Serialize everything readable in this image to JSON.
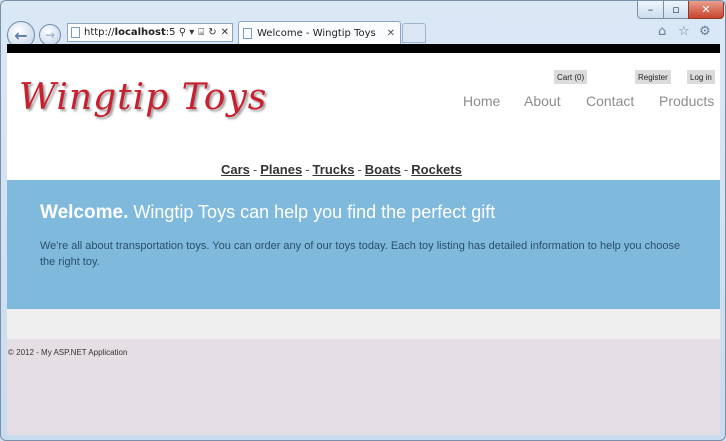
{
  "window": {
    "minimize": "–",
    "maximize": "▫",
    "close": "✕"
  },
  "browser": {
    "back_icon": "←",
    "forward_icon": "→",
    "address_prefix": "http://",
    "address_host": "localhost",
    "address_suffix": ":5",
    "address_tools": [
      "⚲ ▾",
      "⌸",
      "↻",
      "✕"
    ],
    "tab_title": "Welcome - Wingtip Toys",
    "tab_close": "✕",
    "toolbar_icons": {
      "home": "⌂",
      "favorites": "☆",
      "settings": "⚙"
    }
  },
  "site": {
    "logo": "Wingtip Toys",
    "cart": "Cart (0)",
    "register": "Register",
    "login": "Log in",
    "nav": {
      "home": "Home",
      "about": "About",
      "contact": "Contact",
      "products": "Products"
    },
    "categories": [
      "Cars",
      "Planes",
      "Trucks",
      "Boats",
      "Rockets"
    ],
    "separator": "-",
    "hero": {
      "title_bold": "Welcome.",
      "title_rest": " Wingtip Toys can help you find the perfect gift",
      "body": "We're all about transportation toys. You can order any of our toys today. Each toy listing has detailed information to help you choose the right toy."
    },
    "footer": "© 2012 - My ASP.NET Application"
  },
  "colors": {
    "logo": "#c8202f",
    "hero": "#7fbadd",
    "footer": "#e5dfe5"
  }
}
